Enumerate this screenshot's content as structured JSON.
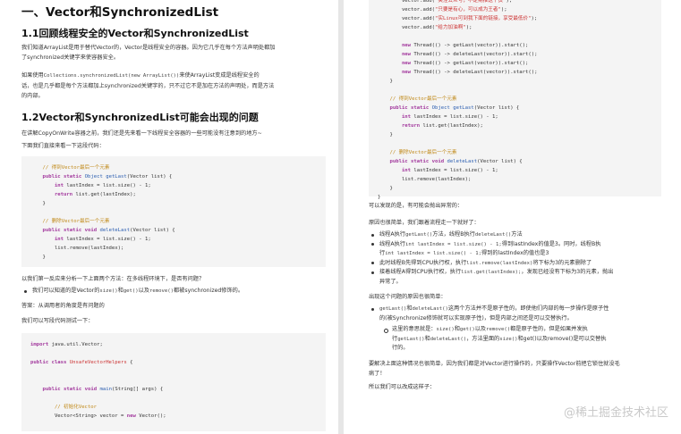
{
  "left": {
    "h1": "一、Vector和SynchronizedList",
    "s11_title": "1.1回顾线程安全的Vector和SynchronizedList",
    "s11_p1": "我们知道ArrayList是用于替代Vector的，Vector是线程安全的容器。因为它几乎在每个方法声明处都加",
    "s11_p2": "了synchronized关键字来使容器安全。",
    "s11_p3_a": "如果使用",
    "s11_p3_code": "Collections.synchronizedList(new ArrayList())",
    "s11_p3_b": "来使ArrayList变成是线程安全的",
    "s11_p4": "话，也是几乎都是每个方法都加上synchronized关键字的，只不过它不是加在方法的声明处，而是方法",
    "s11_p5": "的内部。",
    "s12_title": "1.2Vector和SynchronizedList可能会出现的问题",
    "s12_p1": "在讲解CopyOnWrite容器之前，我们还是先来看一下线程安全容器的一些可能没有注意到的地方~",
    "s12_p2": "下面我们直接来看一下这段代码：",
    "code1": [
      [
        {
          "c": "cm",
          "t": "    // 得到Vector最后一个元素"
        }
      ],
      [
        {
          "c": "kw",
          "t": "    public static "
        },
        {
          "c": "ty",
          "t": "Object "
        },
        {
          "c": "fn",
          "t": "getLast"
        },
        {
          "c": "plain",
          "t": "(Vector list) {"
        }
      ],
      [
        {
          "c": "kw",
          "t": "        int "
        },
        {
          "c": "plain",
          "t": "lastIndex = list.size() - 1;"
        }
      ],
      [
        {
          "c": "kw",
          "t": "        return "
        },
        {
          "c": "plain",
          "t": "list.get(lastIndex);"
        }
      ],
      [
        {
          "c": "plain",
          "t": "    }"
        }
      ],
      [
        {
          "c": "plain",
          "t": ""
        }
      ],
      [
        {
          "c": "cm",
          "t": "    // 删除Vector最后一个元素"
        }
      ],
      [
        {
          "c": "kw",
          "t": "    public static void "
        },
        {
          "c": "fn",
          "t": "deleteLast"
        },
        {
          "c": "plain",
          "t": "(Vector list) {"
        }
      ],
      [
        {
          "c": "kw",
          "t": "        int "
        },
        {
          "c": "plain",
          "t": "lastIndex = list.size() - 1;"
        }
      ],
      [
        {
          "c": "plain",
          "t": "        list.remove(lastIndex);"
        }
      ],
      [
        {
          "c": "plain",
          "t": "    }"
        }
      ]
    ],
    "q1": "以我们第一反应来分析一下上面两个方法：在多线程环境下，是否有问题？",
    "bullet1_a": "我们可以知道的是Vector的",
    "bullet1_code1": "size()",
    "bullet1_b": "和",
    "bullet1_code2": "get()",
    "bullet1_c": "以及",
    "bullet1_code3": "remove()",
    "bullet1_d": "都被synchronized修饰的。",
    "answer": "答案：从调用者的角度是有问题的",
    "test_intro": "我们可以写段代码测试一下：",
    "code2": [
      [
        {
          "c": "kw",
          "t": "import "
        },
        {
          "c": "plain",
          "t": "java.util.Vector;"
        }
      ],
      [
        {
          "c": "plain",
          "t": ""
        }
      ],
      [
        {
          "c": "kw",
          "t": "public class "
        },
        {
          "c": "str",
          "t": "UnsafeVectorHelpers "
        },
        {
          "c": "plain",
          "t": "{"
        }
      ],
      [
        {
          "c": "plain",
          "t": ""
        }
      ],
      [
        {
          "c": "plain",
          "t": ""
        }
      ],
      [
        {
          "c": "kw",
          "t": "    public static void "
        },
        {
          "c": "fn",
          "t": "main"
        },
        {
          "c": "plain",
          "t": "(String[] args) {"
        }
      ],
      [
        {
          "c": "plain",
          "t": ""
        }
      ],
      [
        {
          "c": "cm",
          "t": "        // 初始化Vector"
        }
      ],
      [
        {
          "c": "plain",
          "t": "        Vector<String> vector = "
        },
        {
          "c": "kw",
          "t": "new "
        },
        {
          "c": "plain",
          "t": "Vector();"
        }
      ]
    ]
  },
  "right": {
    "code3": [
      [
        {
          "c": "plain",
          "t": "        vector.add("
        },
        {
          "c": "str",
          "t": "\"关注公众号，不定期推送干货\""
        },
        {
          "c": "plain",
          "t": ");"
        }
      ],
      [
        {
          "c": "plain",
          "t": "        vector.add("
        },
        {
          "c": "str",
          "t": "\"只要是有心，可以成为王者\""
        },
        {
          "c": "plain",
          "t": ");"
        }
      ],
      [
        {
          "c": "plain",
          "t": "        vector.add("
        },
        {
          "c": "str",
          "t": "\"实Linux可到我下面的链接，享受最低价\""
        },
        {
          "c": "plain",
          "t": ");"
        }
      ],
      [
        {
          "c": "plain",
          "t": "        vector.add("
        },
        {
          "c": "str",
          "t": "\"给力加油啊\""
        },
        {
          "c": "plain",
          "t": ");"
        }
      ],
      [
        {
          "c": "plain",
          "t": ""
        }
      ],
      [
        {
          "c": "kw",
          "t": "        new "
        },
        {
          "c": "plain",
          "t": "Thread(() -> getLast(vector)).start();"
        }
      ],
      [
        {
          "c": "kw",
          "t": "        new "
        },
        {
          "c": "plain",
          "t": "Thread(() -> deleteLast(vector)).start();"
        }
      ],
      [
        {
          "c": "kw",
          "t": "        new "
        },
        {
          "c": "plain",
          "t": "Thread(() -> getLast(vector)).start();"
        }
      ],
      [
        {
          "c": "kw",
          "t": "        new "
        },
        {
          "c": "plain",
          "t": "Thread(() -> deleteLast(vector)).start();"
        }
      ],
      [
        {
          "c": "plain",
          "t": "    }"
        }
      ],
      [
        {
          "c": "plain",
          "t": ""
        }
      ],
      [
        {
          "c": "cm",
          "t": "    // 得到Vector最后一个元素"
        }
      ],
      [
        {
          "c": "kw",
          "t": "    public static "
        },
        {
          "c": "ty",
          "t": "Object "
        },
        {
          "c": "fn",
          "t": "getLast"
        },
        {
          "c": "plain",
          "t": "(Vector list) {"
        }
      ],
      [
        {
          "c": "kw",
          "t": "        int "
        },
        {
          "c": "plain",
          "t": "lastIndex = list.size() - 1;"
        }
      ],
      [
        {
          "c": "kw",
          "t": "        return "
        },
        {
          "c": "plain",
          "t": "list.get(lastIndex);"
        }
      ],
      [
        {
          "c": "plain",
          "t": "    }"
        }
      ],
      [
        {
          "c": "plain",
          "t": ""
        }
      ],
      [
        {
          "c": "cm",
          "t": "    // 删除Vector最后一个元素"
        }
      ],
      [
        {
          "c": "kw",
          "t": "    public static void "
        },
        {
          "c": "fn",
          "t": "deleteLast"
        },
        {
          "c": "plain",
          "t": "(Vector list) {"
        }
      ],
      [
        {
          "c": "kw",
          "t": "        int "
        },
        {
          "c": "plain",
          "t": "lastIndex = list.size() - 1;"
        }
      ],
      [
        {
          "c": "plain",
          "t": "        list.remove(lastIndex);"
        }
      ],
      [
        {
          "c": "plain",
          "t": "    }"
        }
      ],
      [
        {
          "c": "plain",
          "t": "}"
        }
      ]
    ],
    "p_found": "可以发现的是，有可能会抛出异常的：",
    "p_reason": "原因也很简单，我们跟着流程走一下就好了：",
    "steps": [
      {
        "a": "线程A执行",
        "code": "getLast()",
        "b": "方法，线程B执行",
        "code2": "deleteLast()",
        "c": "方法"
      },
      {
        "a": "线程A执行",
        "code": "int lastIndex = list.size() - 1;",
        "b": "得到lastIndex的值是3。同时，线程B执",
        "code2": "",
        "c": ""
      },
      {
        "a": "行",
        "code": "int lastIndex = list.size() - 1;",
        "b": "得到的lastIndex的值也是3",
        "code2": "",
        "c": "",
        "cont": true
      },
      {
        "a": "此时线程B先得到CPU执行权，执行",
        "code": "list.remove(lastIndex)",
        "b": "将下标为3的元素删除了",
        "code2": "",
        "c": ""
      },
      {
        "a": "接着线程A得到CPU执行权，执行",
        "code": "list.get(lastIndex);",
        "b": "，发现已经没有下标为3的元素，抛出",
        "code2": "",
        "c": ""
      },
      {
        "a": "异常了。",
        "code": "",
        "b": "",
        "code2": "",
        "c": "",
        "cont": true
      }
    ],
    "p_cause": "出现这个问题的原因也很简单：",
    "cause_lines": [
      {
        "code": "getLast()",
        "a": "和",
        "code2": "deleteLast()",
        "b": "这两个方法并不是原子性的，即使他们内部的每一步操作是原子性"
      },
      {
        "code": "",
        "a": "的(被Synchronize修饰就可以实现原子性)，但是内部之间还是可以交替执行。",
        "code2": "",
        "b": "",
        "cont": true
      }
    ],
    "sub_lines": [
      {
        "a": "这里的意思就是：",
        "code": "size()",
        "b": "和",
        "code2": "get()",
        "c": "以及",
        "code3": "remove()",
        "d": "都是原子性的，但是如果并发执"
      },
      {
        "a": "行",
        "code": "getLast()",
        "b": "和",
        "code2": "deleteLast()",
        "c": "，方法里面的",
        "code3": "size()",
        "d": "和get()以及remove()是可以交替执",
        "cont": true
      },
      {
        "a": "行的。",
        "code": "",
        "b": "",
        "code2": "",
        "c": "",
        "code3": "",
        "d": "",
        "cont": true
      }
    ],
    "p_fix1": "要解决上面这种情况也很简单，因为我们都是对Vector进行操作的，只要操作Vector前把它锁住就没毛",
    "p_fix2": "病了！",
    "p_fix3": "所以我们可以改成这样子："
  },
  "watermark": "@稀土掘金技术社区"
}
